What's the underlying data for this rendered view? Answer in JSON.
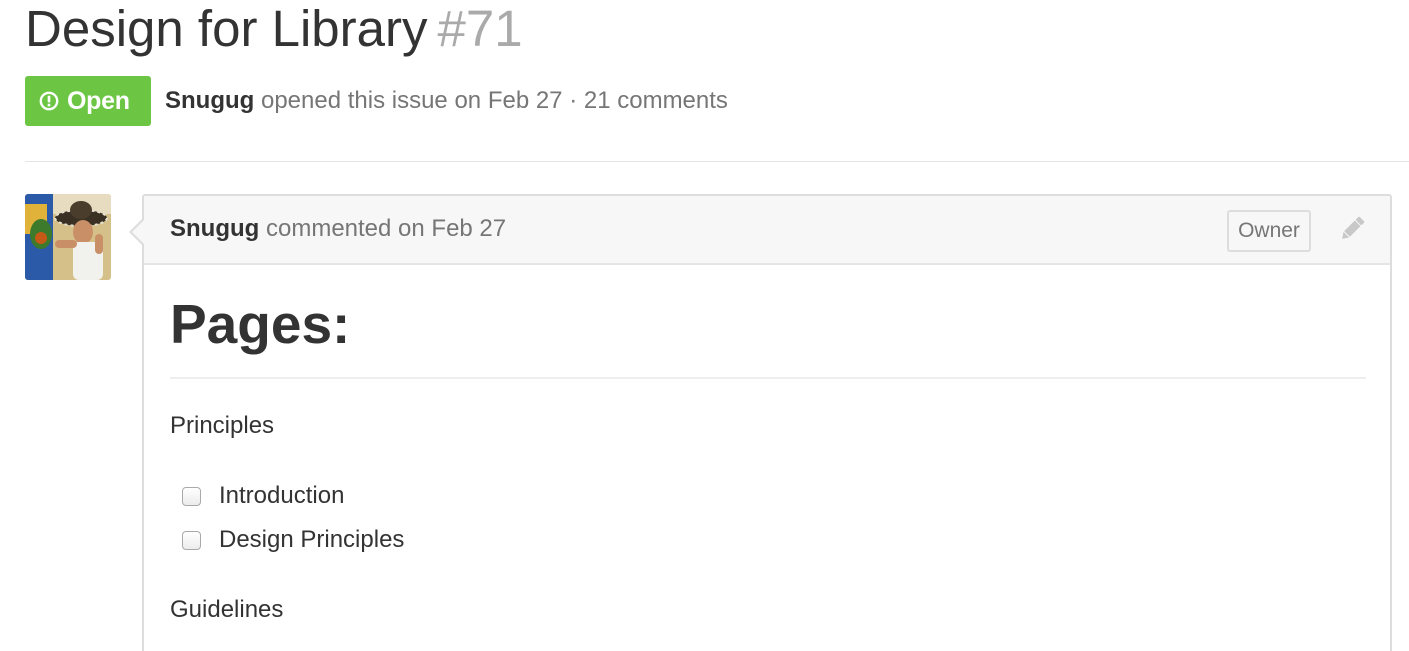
{
  "issue": {
    "title": "Design for Library",
    "number": "#71",
    "state": "Open",
    "author": "Snugug",
    "meta_suffix": "opened this issue on Feb 27 · 21 comments"
  },
  "comment": {
    "author": "Snugug",
    "action": "commented on Feb 27",
    "owner_label": "Owner",
    "body": {
      "heading": "Pages:",
      "sections": [
        {
          "label": "Principles",
          "tasks": [
            {
              "label": "Introduction",
              "checked": false
            },
            {
              "label": "Design Principles",
              "checked": false
            }
          ]
        },
        {
          "label": "Guidelines",
          "tasks": []
        }
      ]
    }
  },
  "icons": {
    "state": "issue-opened-icon",
    "edit": "pencil-icon"
  },
  "colors": {
    "open_badge": "#6cc644",
    "muted_text": "#767676",
    "issue_number": "#aaaaaa"
  }
}
